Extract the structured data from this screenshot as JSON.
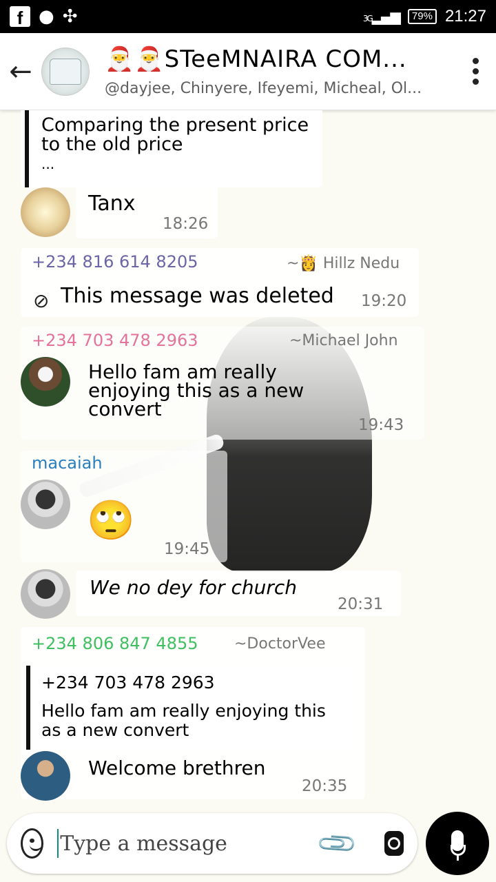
{
  "status_bar": {
    "fb_glyph": "f",
    "network": "3G",
    "battery": "79%",
    "time": "21:27"
  },
  "header": {
    "title_emoji": "🎅🎅",
    "title": "STeeMNAIRA COM...",
    "members": "@dayjee, Chinyere, Ifeyemi, Micheal, Ol..."
  },
  "messages": {
    "quote1": {
      "text_line1": "Comparing the present price",
      "text_line2": "to the old price",
      "text_line3": "..."
    },
    "tanx": {
      "text": "Tanx",
      "time": "18:26"
    },
    "deleted": {
      "sender": "+234 816 614 8205",
      "alias": "~👸 Hillz Nedu",
      "text": "This message was deleted",
      "time": "19:20"
    },
    "michael": {
      "sender": "+234 703 478 2963",
      "alias": "~Michael John",
      "line1": "Hello fam am really",
      "line2": "enjoying this as a new",
      "line3": "convert",
      "time": "19:43"
    },
    "macaiah": {
      "sender": "macaiah",
      "emoji": "🙄",
      "time": "19:45"
    },
    "church": {
      "text": "We no dey for church",
      "time": "20:31"
    },
    "doctorvee": {
      "sender": "+234 806 847 4855",
      "alias": "~DoctorVee",
      "quote_sender": "+234 703 478 2963",
      "quote_line1": "Hello fam am really enjoying this",
      "quote_line2": "as a new convert",
      "text": "Welcome brethren",
      "time": "20:35"
    }
  },
  "composer": {
    "placeholder": "Type a message"
  },
  "colors": {
    "sender_purple": "#6b64a6",
    "sender_pink": "#e3739b",
    "sender_blue": "#2a7fbf",
    "sender_green": "#3fbf5f"
  }
}
